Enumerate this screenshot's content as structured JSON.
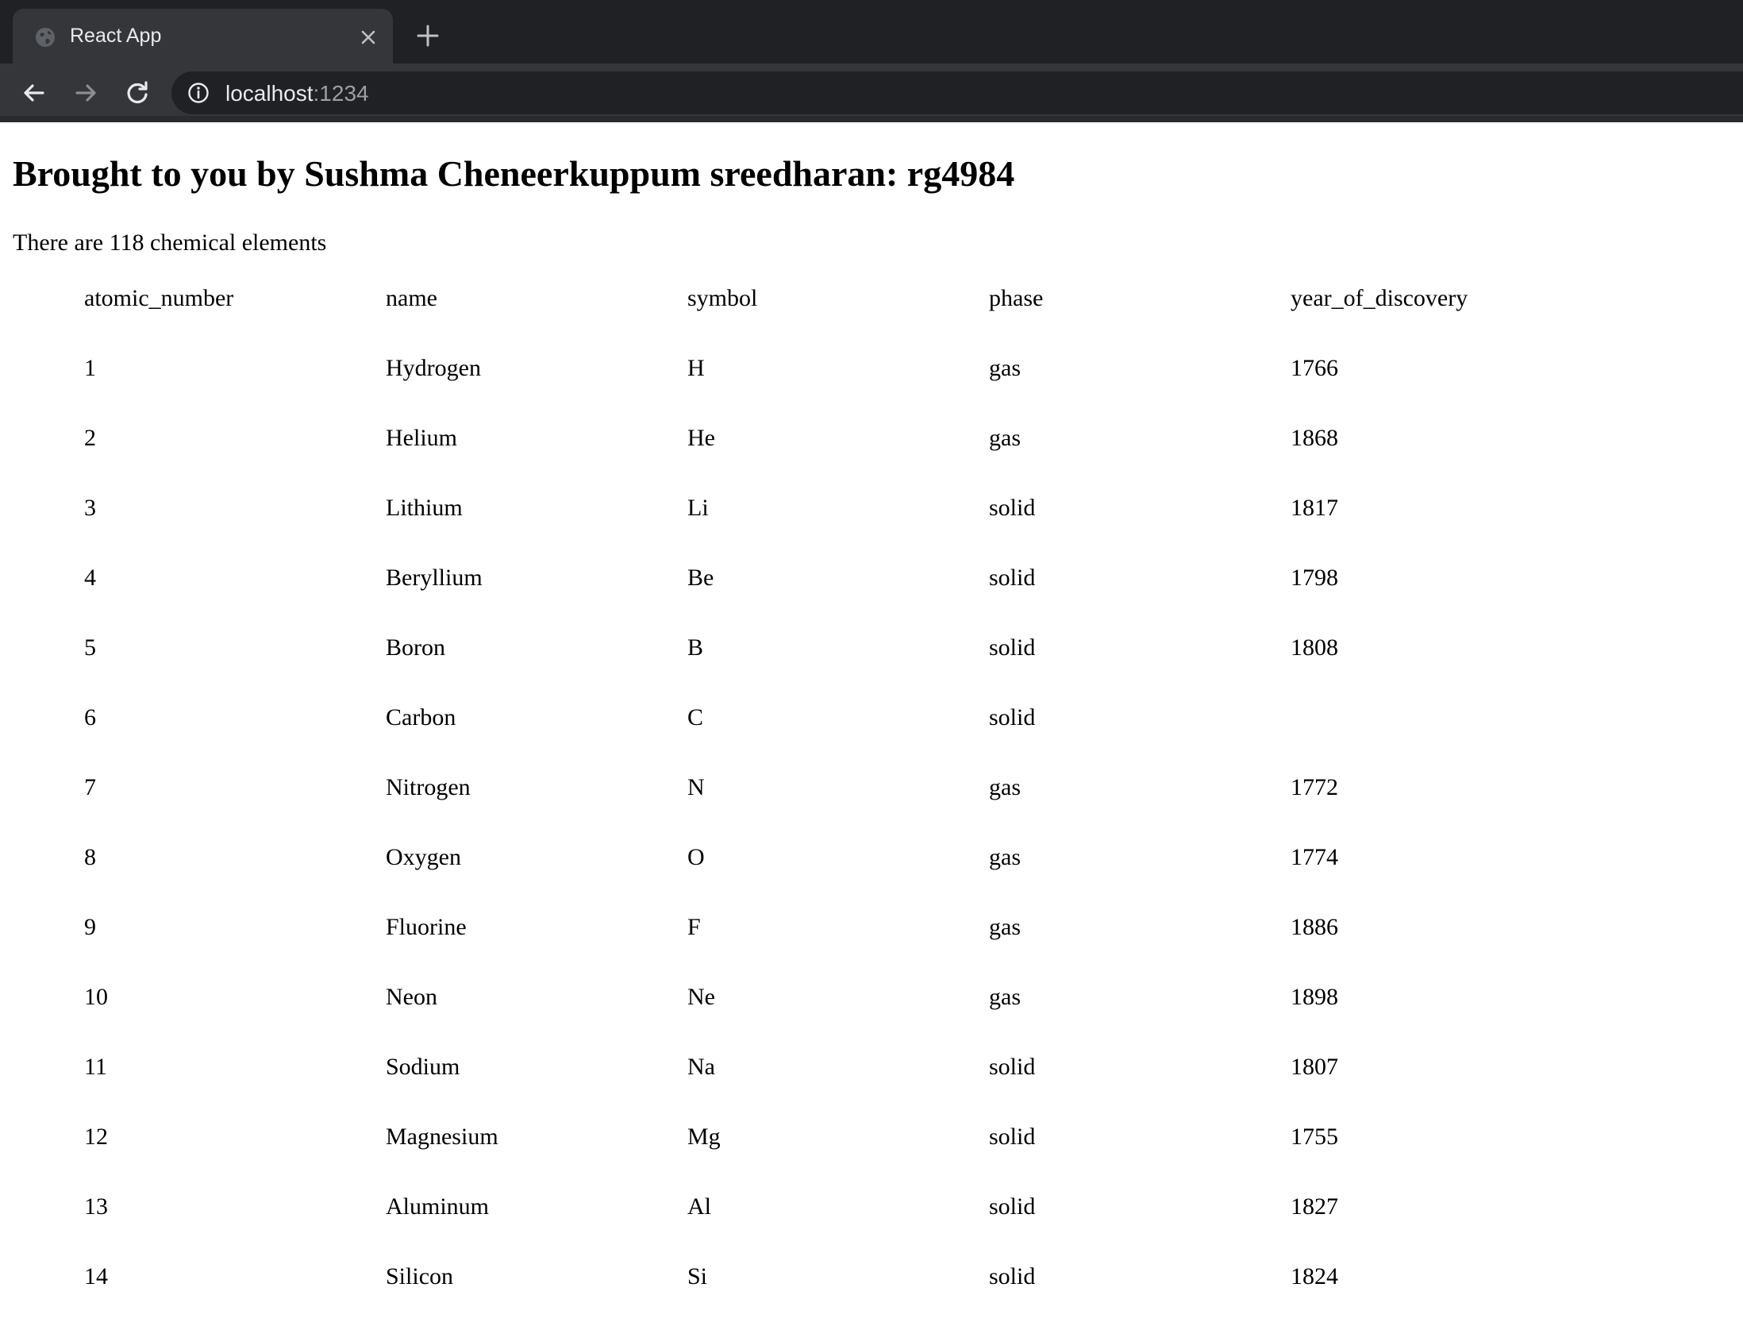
{
  "browser": {
    "tab_title": "React App",
    "url_host": "localhost",
    "url_port": ":1234",
    "colors": {
      "tabstrip": "#202124",
      "toolbar": "#35363a",
      "omnibox": "#202124",
      "text_light": "#e8eaed",
      "text_muted": "#9aa0a6"
    },
    "icons": {
      "favicon": "globe-icon",
      "close": "close-icon",
      "new_tab": "plus-icon",
      "back": "arrow-left-icon",
      "forward": "arrow-right-icon",
      "reload": "reload-icon",
      "site_info": "info-icon"
    }
  },
  "page": {
    "heading": "Brought to you by Sushma Cheneerkuppum sreedharan: rg4984",
    "summary": "There are 118 chemical elements",
    "table": {
      "columns": [
        "atomic_number",
        "name",
        "symbol",
        "phase",
        "year_of_discovery"
      ],
      "rows": [
        [
          "1",
          "Hydrogen",
          "H",
          "gas",
          "1766"
        ],
        [
          "2",
          "Helium",
          "He",
          "gas",
          "1868"
        ],
        [
          "3",
          "Lithium",
          "Li",
          "solid",
          "1817"
        ],
        [
          "4",
          "Beryllium",
          "Be",
          "solid",
          "1798"
        ],
        [
          "5",
          "Boron",
          "B",
          "solid",
          "1808"
        ],
        [
          "6",
          "Carbon",
          "C",
          "solid",
          ""
        ],
        [
          "7",
          "Nitrogen",
          "N",
          "gas",
          "1772"
        ],
        [
          "8",
          "Oxygen",
          "O",
          "gas",
          "1774"
        ],
        [
          "9",
          "Fluorine",
          "F",
          "gas",
          "1886"
        ],
        [
          "10",
          "Neon",
          "Ne",
          "gas",
          "1898"
        ],
        [
          "11",
          "Sodium",
          "Na",
          "solid",
          "1807"
        ],
        [
          "12",
          "Magnesium",
          "Mg",
          "solid",
          "1755"
        ],
        [
          "13",
          "Aluminum",
          "Al",
          "solid",
          "1827"
        ],
        [
          "14",
          "Silicon",
          "Si",
          "solid",
          "1824"
        ]
      ]
    }
  }
}
